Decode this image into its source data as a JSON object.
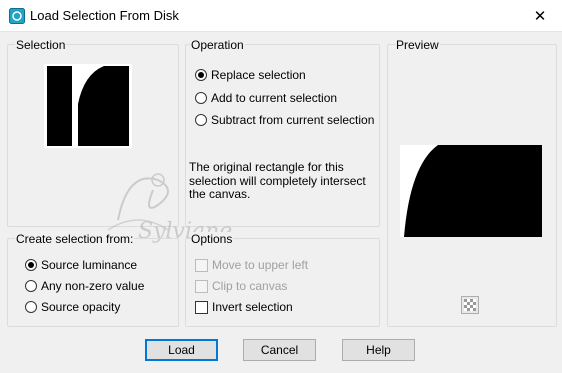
{
  "window": {
    "title": "Load Selection From Disk",
    "close_glyph": "✕",
    "icon": "selection-disk-icon"
  },
  "selection_group": {
    "label": "Selection"
  },
  "operation_group": {
    "label": "Operation",
    "options": [
      {
        "label": "Replace selection",
        "checked": true
      },
      {
        "label": "Add to current selection",
        "checked": false
      },
      {
        "label": "Subtract from current selection",
        "checked": false
      }
    ],
    "info": "The original rectangle for this selection will completely intersect the canvas."
  },
  "preview_group": {
    "label": "Preview"
  },
  "create_group": {
    "label": "Create selection from:",
    "options": [
      {
        "label": "Source luminance",
        "checked": true
      },
      {
        "label": "Any non-zero value",
        "checked": false
      },
      {
        "label": "Source opacity",
        "checked": false
      }
    ]
  },
  "options_group": {
    "label": "Options",
    "items": [
      {
        "label": "Move to upper left",
        "checked": false,
        "enabled": false
      },
      {
        "label": "Clip to canvas",
        "checked": false,
        "enabled": false
      },
      {
        "label": "Invert selection",
        "checked": false,
        "enabled": true
      }
    ]
  },
  "watermark": {
    "text": "Sylviane"
  },
  "buttons": {
    "load": "Load",
    "cancel": "Cancel",
    "help": "Help"
  },
  "colors": {
    "accent": "#0078d7",
    "background": "#f0f0f0",
    "group_border": "#dcdcdc"
  }
}
